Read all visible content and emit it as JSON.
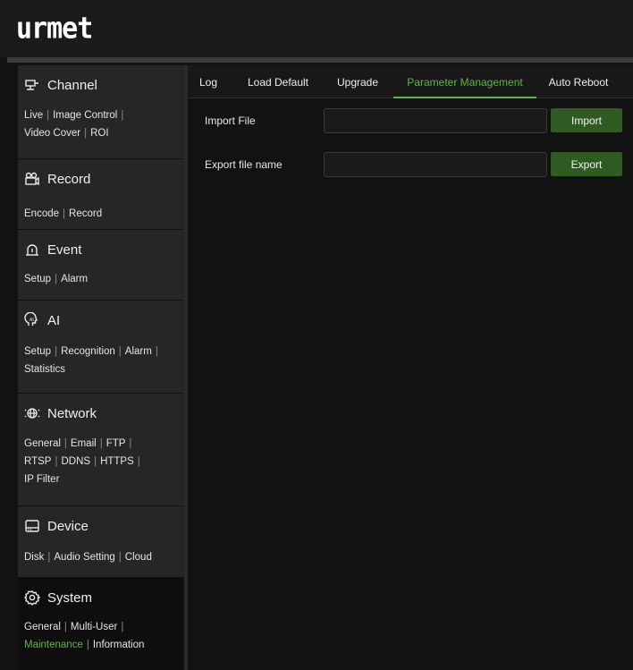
{
  "brand": {
    "logo_text": "urmet"
  },
  "sidebar": {
    "sections": [
      {
        "title": "Channel",
        "icon": "channel-icon",
        "links": [
          "Live",
          "Image Control",
          "Video Cover",
          "ROI"
        ]
      },
      {
        "title": "Record",
        "icon": "record-icon",
        "links": [
          "Encode",
          "Record"
        ]
      },
      {
        "title": "Event",
        "icon": "event-alarm-icon",
        "links": [
          "Setup",
          "Alarm"
        ]
      },
      {
        "title": "AI",
        "icon": "ai-head-icon",
        "links": [
          "Setup",
          "Recognition",
          "Alarm",
          "Statistics"
        ]
      },
      {
        "title": "Network",
        "icon": "network-globe-icon",
        "links": [
          "General",
          "Email",
          "FTP",
          "RTSP",
          "DDNS",
          "HTTPS",
          "IP Filter"
        ]
      },
      {
        "title": "Device",
        "icon": "device-disk-icon",
        "links": [
          "Disk",
          "Audio Setting",
          "Cloud"
        ]
      },
      {
        "title": "System",
        "icon": "system-gear-icon",
        "links": [
          "General",
          "Multi-User",
          "Maintenance",
          "Information"
        ],
        "active_link": "Maintenance"
      }
    ]
  },
  "tabs": [
    {
      "label": "Log"
    },
    {
      "label": "Load Default"
    },
    {
      "label": "Upgrade"
    },
    {
      "label": "Parameter Management",
      "active": true
    },
    {
      "label": "Auto Reboot"
    }
  ],
  "form": {
    "import": {
      "label": "Import File",
      "value": "",
      "button": "Import"
    },
    "export": {
      "label": "Export file name",
      "value": "",
      "button": "Export"
    }
  },
  "colors": {
    "accent": "#63b34b",
    "button_bg": "#2f5b22",
    "sidebar_bg": "#262626",
    "active_section_bg": "#0e0e0e"
  }
}
